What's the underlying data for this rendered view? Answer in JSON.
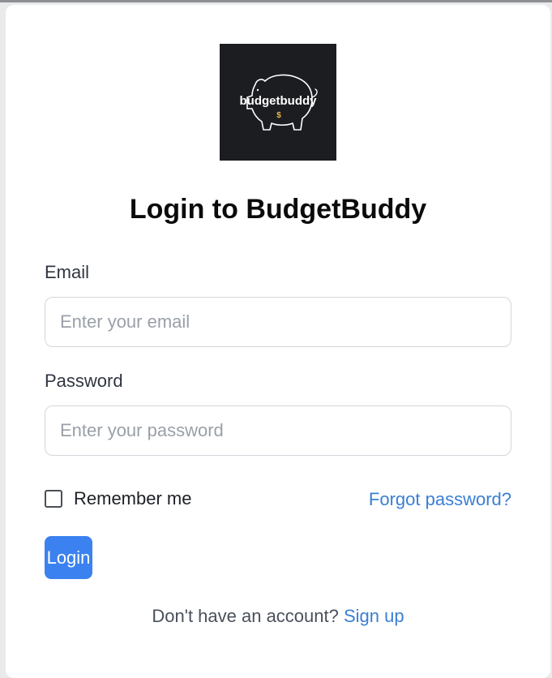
{
  "logo": {
    "text": "budgetbuddy",
    "symbol": "$",
    "icon": "piggy-bank-icon"
  },
  "title": "Login to BudgetBuddy",
  "form": {
    "email": {
      "label": "Email",
      "placeholder": "Enter your email",
      "value": ""
    },
    "password": {
      "label": "Password",
      "placeholder": "Enter your password",
      "value": ""
    },
    "remember_label": "Remember me",
    "remember_checked": false,
    "forgot_link": "Forgot password?",
    "login_button": "Login"
  },
  "footer": {
    "prompt": "Don't have an account?",
    "signup_link": "Sign up"
  },
  "colors": {
    "accent": "#3b82f0",
    "link": "#3a7fd4",
    "logo_bg": "#1c1d21",
    "logo_symbol": "#e8b84a"
  }
}
